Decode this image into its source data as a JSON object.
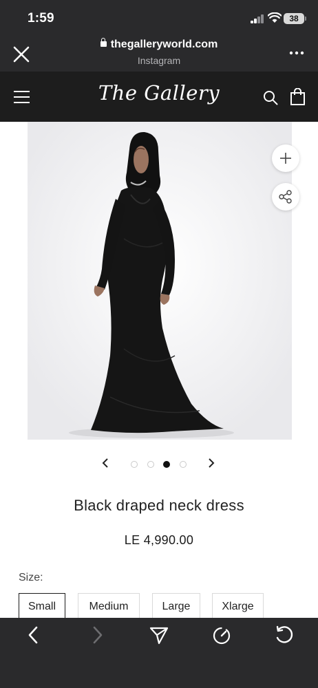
{
  "status_bar": {
    "time": "1:59",
    "battery": "38"
  },
  "browser": {
    "url": "thegalleryworld.com",
    "source": "Instagram",
    "icons": [
      "close-icon",
      "lock-icon",
      "more-icon"
    ]
  },
  "header": {
    "logo": "The Gallery",
    "icons": [
      "menu-icon",
      "search-icon",
      "cart-icon"
    ]
  },
  "gallery": {
    "slide_count": 4,
    "active_slide": 3,
    "icons": [
      "zoom-plus-icon",
      "share-icon",
      "chevron-left-icon",
      "chevron-right-icon"
    ]
  },
  "product": {
    "title": "Black draped neck dress",
    "price": "LE 4,990.00",
    "size_label": "Size:",
    "sizes": [
      "Small",
      "Medium",
      "Large",
      "Xlarge"
    ],
    "selected_size": "Small"
  },
  "toolbar": {
    "icons": [
      "back-icon",
      "forward-icon",
      "send-icon",
      "speed-icon",
      "reload-icon"
    ]
  },
  "colors": {
    "browser_chrome": "#2a2a2c",
    "site_header": "#1d1d1d",
    "dress": "#111111",
    "accent_text": "#222222"
  }
}
